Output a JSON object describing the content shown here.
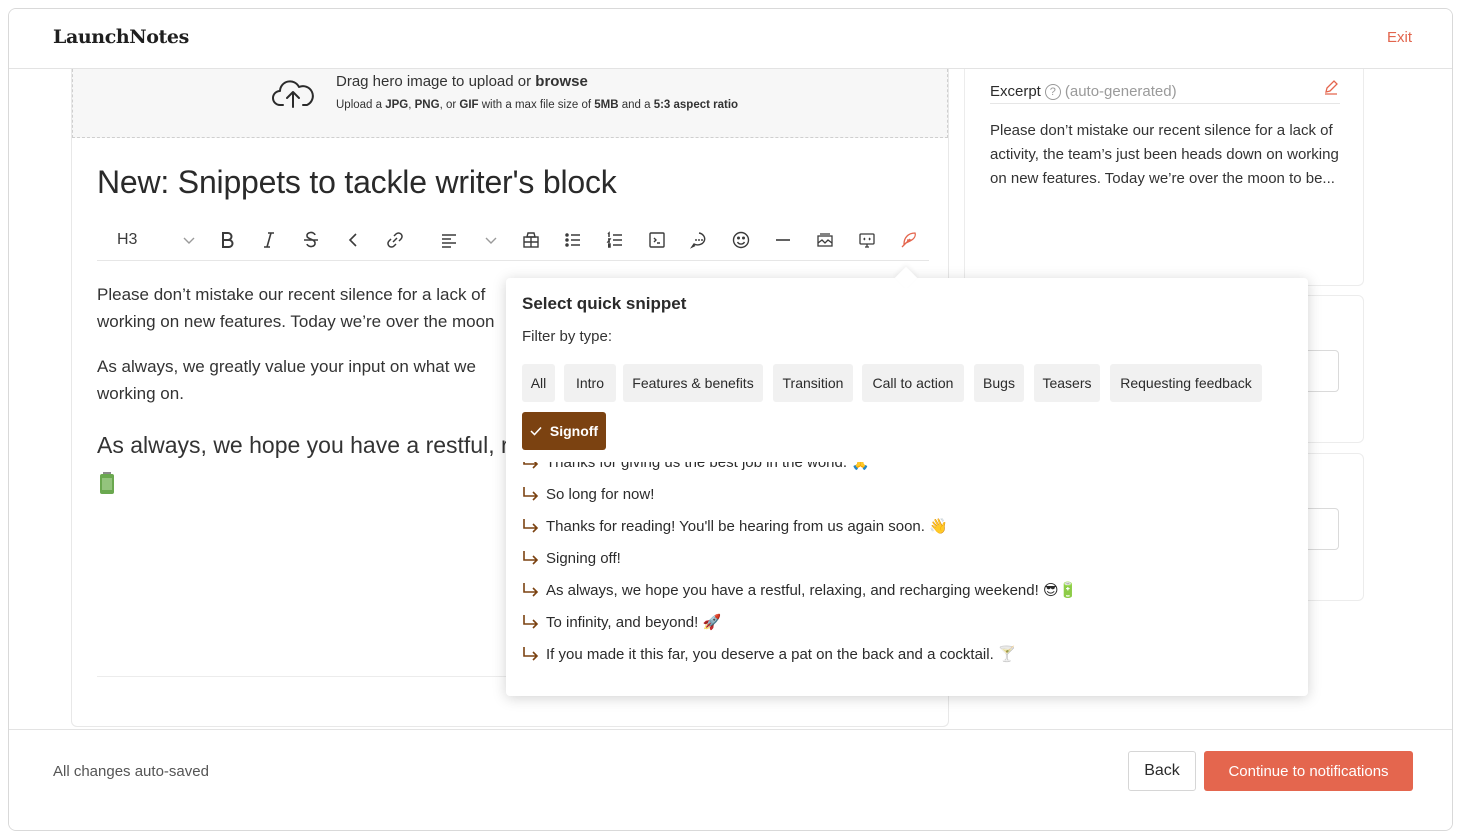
{
  "app": {
    "logo": "LaunchNotes",
    "exit_label": "Exit"
  },
  "upload": {
    "title_prefix": "Drag hero image to upload or ",
    "title_link": "browse",
    "sub_1": "Upload a ",
    "fmt_jpg": "JPG",
    "sep_1": ", ",
    "fmt_png": "PNG",
    "sep_2": ", or ",
    "fmt_gif": "GIF",
    "sub_2": " with a max file size of ",
    "size": "5MB",
    "sub_3": " and a ",
    "ratio": "5:3 aspect ratio"
  },
  "editor": {
    "title": "New: Snippets to tackle writer's block",
    "heading_select": "H3",
    "paragraph_1": "Please don’t mistake our recent silence for a lack of activity, the team’s just been heads down on working on new features.  Today we’re over the moon to be sharing...",
    "paragraph_1_line1": "Please don’t mistake our recent silence for a lack of",
    "paragraph_1_line2": "working on new features.  Today we’re over the moon",
    "paragraph_2_line1": "As always, we greatly value your input on what we",
    "paragraph_2_line2": "working on.",
    "heading_line": "As always, we hope you have a restful, relaxing,"
  },
  "excerpt": {
    "label": "Excerpt",
    "help": "?",
    "auto": "(auto-generated)",
    "text": "Please don’t mistake our recent silence for a lack of activity, the team’s just been heads down on working on new features. Today we’re over the moon to be..."
  },
  "snippet_popup": {
    "title": "Select quick snippet",
    "filter_label": "Filter by type:",
    "filters": [
      "All",
      "Intro",
      "Features & benefits",
      "Transition",
      "Call to action",
      "Bugs",
      "Teasers",
      "Requesting feedback",
      "Signoff"
    ],
    "active_filter": "Signoff",
    "snippets": [
      "Thanks for giving us the best job in the world. 🙏",
      "So long for now!",
      "Thanks for reading! You'll be hearing from us again soon. 👋",
      "Signing off!",
      "As always, we hope you have a restful, relaxing, and recharging weekend! 😎🔋",
      "To infinity, and beyond! 🚀",
      "If you made it this far, you deserve a pat on the back and a cocktail. 🍸"
    ]
  },
  "footer": {
    "saved_status": "All changes auto-saved",
    "back_label": "Back",
    "continue_label": "Continue to notifications"
  },
  "colors": {
    "accent": "#e4664e",
    "active_chip": "#7b4211"
  }
}
